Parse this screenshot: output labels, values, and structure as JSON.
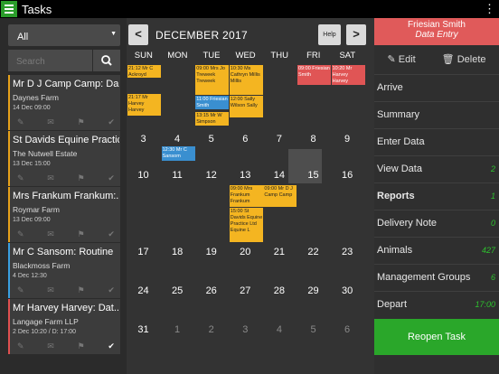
{
  "app": {
    "title": "Tasks"
  },
  "left": {
    "filter_value": "All",
    "search_placeholder": "Search",
    "tasks": [
      {
        "name": "Mr D J Camp Camp: Da...",
        "location": "Daynes Farm",
        "date": "14 Dec 09:00",
        "status": "orange"
      },
      {
        "name": "St Davids Equine Practic...",
        "location": "The Nutwell Estate",
        "date": "13 Dec 15:00",
        "status": "orange"
      },
      {
        "name": "Mrs Frankum Frankum:...",
        "location": "Roymar Farm",
        "date": "13 Dec 09:00",
        "status": "orange"
      },
      {
        "name": "Mr C Sansom: Routine",
        "location": "Blackmoss Farm",
        "date": "4 Dec 12:30",
        "status": "blue"
      },
      {
        "name": "Mr Harvey Harvey: Dat...",
        "location": "Langage Farm LLP",
        "date": "2 Dec 10:20 / D: 17:00",
        "status": "red"
      }
    ]
  },
  "calendar": {
    "month": "DECEMBER 2017",
    "help": "Help",
    "prev": "<",
    "next": ">",
    "weekdays": [
      "SUN",
      "MON",
      "TUE",
      "WED",
      "THU",
      "FRI",
      "SAT"
    ],
    "weeks": [
      [
        {
          "d": "",
          "o": false
        },
        {
          "d": "",
          "o": false
        },
        {
          "d": "",
          "o": false
        },
        {
          "d": "",
          "o": false
        },
        {
          "d": "",
          "o": false
        },
        {
          "d": "1",
          "o": false
        },
        {
          "d": "2",
          "o": false
        }
      ],
      [
        {
          "d": "3",
          "o": false
        },
        {
          "d": "4",
          "o": false
        },
        {
          "d": "5",
          "o": false
        },
        {
          "d": "6",
          "o": false
        },
        {
          "d": "7",
          "o": false
        },
        {
          "d": "8",
          "o": false
        },
        {
          "d": "9",
          "o": false
        }
      ],
      [
        {
          "d": "10",
          "o": false
        },
        {
          "d": "11",
          "o": false
        },
        {
          "d": "12",
          "o": false
        },
        {
          "d": "13",
          "o": false
        },
        {
          "d": "14",
          "o": false
        },
        {
          "d": "15",
          "o": false
        },
        {
          "d": "16",
          "o": false
        }
      ],
      [
        {
          "d": "17",
          "o": false
        },
        {
          "d": "18",
          "o": false
        },
        {
          "d": "19",
          "o": false
        },
        {
          "d": "20",
          "o": false
        },
        {
          "d": "21",
          "o": false
        },
        {
          "d": "22",
          "o": false
        },
        {
          "d": "23",
          "o": false
        }
      ],
      [
        {
          "d": "24",
          "o": false
        },
        {
          "d": "25",
          "o": false
        },
        {
          "d": "26",
          "o": false
        },
        {
          "d": "27",
          "o": false
        },
        {
          "d": "28",
          "o": false
        },
        {
          "d": "29",
          "o": false
        },
        {
          "d": "30",
          "o": false
        }
      ],
      [
        {
          "d": "31",
          "o": false
        },
        {
          "d": "1",
          "o": true
        },
        {
          "d": "2",
          "o": true
        },
        {
          "d": "3",
          "o": true
        },
        {
          "d": "4",
          "o": true
        },
        {
          "d": "5",
          "o": true
        },
        {
          "d": "6",
          "o": true
        }
      ]
    ],
    "events": [
      {
        "week": 0,
        "day": 0,
        "slot": 0,
        "color": "orange",
        "text": "21:12 Mr C Ackroyd"
      },
      {
        "week": 0,
        "day": 0,
        "slot": 1,
        "color": "orange",
        "text": "21:17 Mr Harvey Harvey"
      },
      {
        "week": 0,
        "day": 2,
        "slot": 0,
        "color": "orange",
        "text": "09:00 Mrs Jo Treweek Treweek"
      },
      {
        "week": 0,
        "day": 2,
        "slot": 1,
        "color": "blue",
        "text": "11:00 Friesian Smith"
      },
      {
        "week": 0,
        "day": 2,
        "slot": 2,
        "color": "orange",
        "text": "13:15 Mr W Simpson"
      },
      {
        "week": 0,
        "day": 3,
        "slot": 0,
        "color": "orange",
        "text": "10:30 Ms Cathryn Millis Millis"
      },
      {
        "week": 0,
        "day": 3,
        "slot": 1,
        "color": "orange",
        "text": "12:00 Sally Wilson Sally"
      },
      {
        "week": 0,
        "day": 5,
        "slot": 0,
        "color": "red",
        "text": "09:00 Friesian Smith"
      },
      {
        "week": 0,
        "day": 6,
        "slot": 0,
        "color": "red",
        "text": "10:20 Mr Harvey Harvey"
      },
      {
        "week": 1,
        "day": 1,
        "slot": 0,
        "color": "blue",
        "text": "12:30 Mr C Sansom"
      },
      {
        "week": 2,
        "day": 3,
        "slot": 0,
        "color": "orange",
        "text": "09:00 Mrs Frankum Frankum"
      },
      {
        "week": 2,
        "day": 3,
        "slot": 1,
        "color": "orange",
        "text": "15:00 St Davids Equine Practice Ltd Equine L"
      },
      {
        "week": 2,
        "day": 4,
        "slot": 0,
        "color": "orange",
        "text": "09:00 Mr D J Camp Camp"
      }
    ]
  },
  "detail": {
    "name": "Friesian Smith",
    "type": "Data Entry",
    "edit": "Edit",
    "delete": "Delete",
    "rows": [
      {
        "label": "Arrive",
        "value": "",
        "bold": false
      },
      {
        "label": "Summary",
        "value": "",
        "bold": false
      },
      {
        "label": "Enter Data",
        "value": "",
        "bold": false
      },
      {
        "label": "View Data",
        "value": "2",
        "bold": false
      },
      {
        "label": "Reports",
        "value": "1",
        "bold": true
      },
      {
        "label": "Delivery Note",
        "value": "0",
        "bold": false
      },
      {
        "label": "Animals",
        "value": "427",
        "bold": false
      },
      {
        "label": "Management Groups",
        "value": "6",
        "bold": false
      },
      {
        "label": "Depart",
        "value": "17:00",
        "bold": false
      }
    ],
    "reopen": "Reopen Task"
  },
  "colors": {
    "orange": "#f4b521",
    "blue": "#3a8fd0",
    "red": "#e05555",
    "green": "#2aa72a"
  }
}
